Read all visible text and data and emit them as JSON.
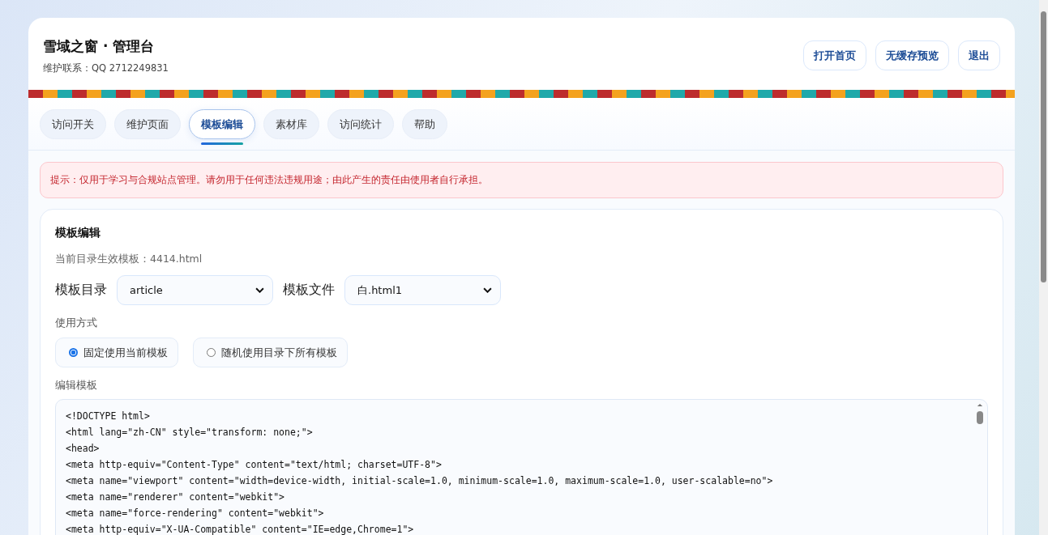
{
  "header": {
    "title": "雪域之窗 · 管理台",
    "contact": "维护联系：QQ 2712249831"
  },
  "header_buttons": [
    "打开首页",
    "无缓存预览",
    "退出"
  ],
  "tabs": [
    {
      "label": "访问开关",
      "selected": false
    },
    {
      "label": "维护页面",
      "selected": false
    },
    {
      "label": "模板编辑",
      "selected": true
    },
    {
      "label": "素材库",
      "selected": false
    },
    {
      "label": "访问统计",
      "selected": false
    },
    {
      "label": "帮助",
      "selected": false
    }
  ],
  "notice": "提示：仅用于学习与合规站点管理。请勿用于任何违法违规用途；由此产生的责任由使用者自行承担。",
  "editor": {
    "title": "模板编辑",
    "current_template": "当前目录生效模板：4414.html",
    "directory": {
      "label": "模板目录",
      "value": "article"
    },
    "file": {
      "label": "模板文件",
      "value": "白.html1"
    },
    "usage_label": "使用方式",
    "usage_options": [
      {
        "label": "固定使用当前模板",
        "selected": true
      },
      {
        "label": "随机使用目录下所有模板",
        "selected": false
      }
    ],
    "code_label": "编辑模板",
    "code_lines": [
      "<!DOCTYPE html>",
      "<html lang=\"zh-CN\" style=\"transform: none;\">",
      "<head>",
      "<meta http-equiv=\"Content-Type\" content=\"text/html; charset=UTF-8\">",
      "<meta name=\"viewport\" content=\"width=device-width, initial-scale=1.0, minimum-scale=1.0, maximum-scale=1.0, user-scalable=no\">",
      "<meta name=\"renderer\" content=\"webkit\">",
      "<meta name=\"force-rendering\" content=\"webkit\">",
      "<meta http-equiv=\"X-UA-Compatible\" content=\"IE=edge,Chrome=1\">"
    ]
  }
}
